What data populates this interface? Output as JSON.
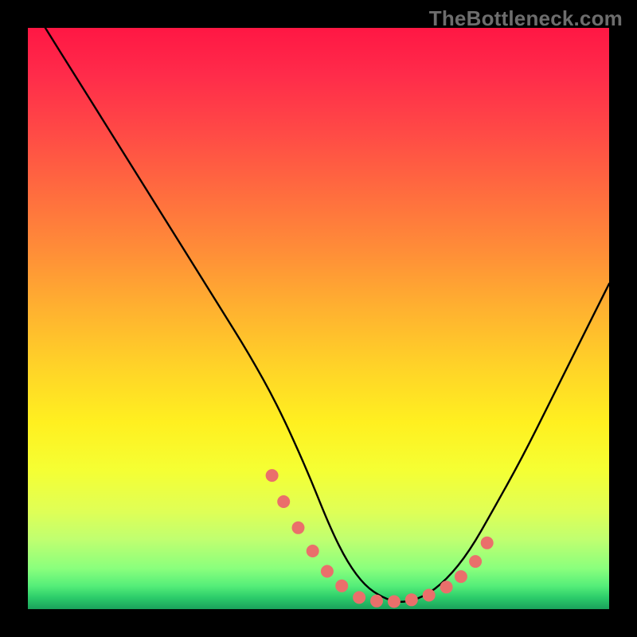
{
  "watermark": "TheBottleneck.com",
  "chart_data": {
    "type": "line",
    "title": "",
    "xlabel": "",
    "ylabel": "",
    "xlim": [
      0,
      100
    ],
    "ylim": [
      0,
      100
    ],
    "grid": false,
    "series": [
      {
        "name": "curve",
        "x": [
          3,
          8,
          13,
          18,
          23,
          28,
          33,
          38,
          43,
          48,
          52,
          55,
          58,
          61,
          64,
          68,
          72,
          76,
          80,
          85,
          90,
          95,
          100
        ],
        "y": [
          100,
          92,
          84,
          76,
          68,
          60,
          52,
          44,
          35,
          24,
          14,
          8,
          4,
          2,
          1,
          2,
          5,
          10,
          17,
          26,
          36,
          46,
          56
        ]
      }
    ],
    "dots": {
      "name": "markers",
      "x": [
        42,
        44,
        46.5,
        49,
        51.5,
        54,
        57,
        60,
        63,
        66,
        69,
        72,
        74.5,
        77,
        79
      ],
      "y": [
        23,
        18.5,
        14,
        10,
        6.5,
        4,
        2,
        1.4,
        1.3,
        1.6,
        2.4,
        3.8,
        5.6,
        8.2,
        11.4
      ]
    },
    "colors": {
      "curve": "#000000",
      "dots": "#ea6f6b",
      "gradient_top": "#ff1744",
      "gradient_bottom": "#1aa05b"
    }
  }
}
